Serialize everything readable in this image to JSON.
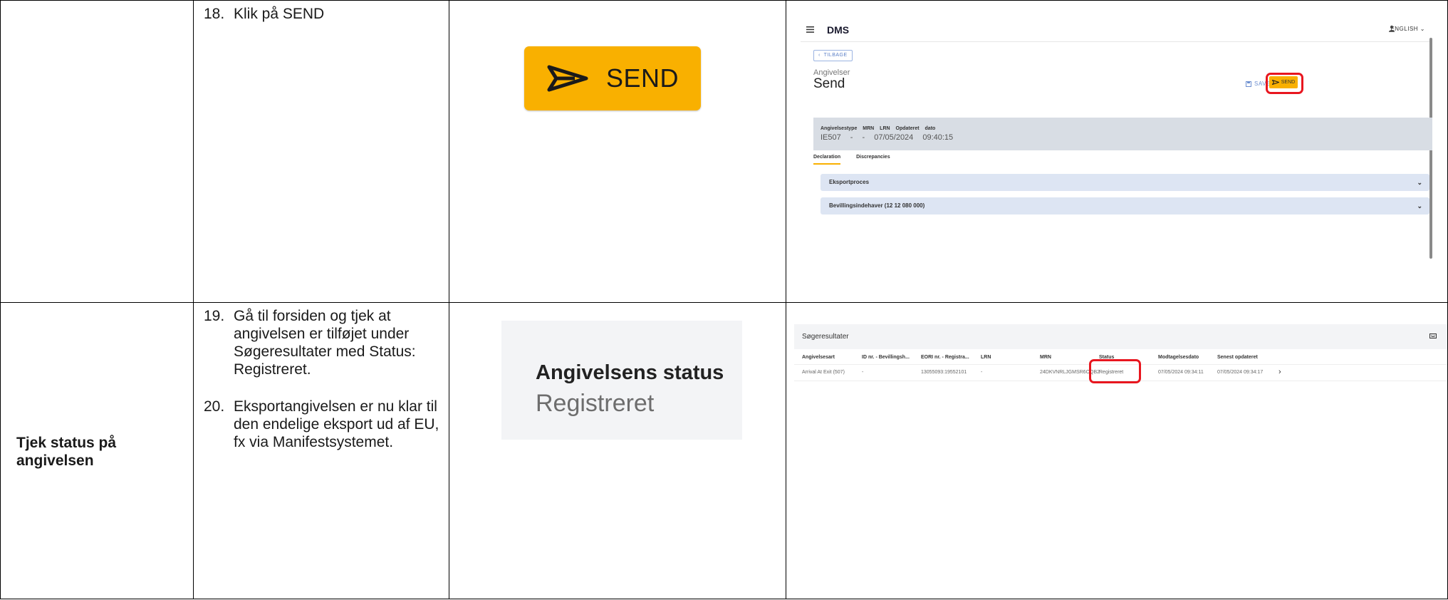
{
  "rows": [
    {
      "title": "",
      "steps": [
        {
          "num": "18.",
          "text": "Klik på SEND"
        }
      ],
      "zoom": {
        "label": "SEND",
        "icon": "send-icon",
        "color": "#f9b000"
      },
      "screenshot": {
        "brand": "DMS",
        "language": "ENGLISH",
        "back_label": "TILBAGE",
        "breadcrumb": "Angivelser",
        "heading": "Send",
        "save_label": "SAVE",
        "send_label": "SEND",
        "info_header": "Angivelsestype  MRN  LRN  Opdateret dato",
        "info_values": "IE507   -   -   07/05/2024 09:40:15",
        "tabs": [
          "Declaration",
          "Discrepancies"
        ],
        "accordions": [
          "Eksportproces",
          "Bevillingsindehaver (12 12 080 000)"
        ],
        "highlight_color": "#e8161f"
      }
    },
    {
      "title": "Tjek status på angivelsen",
      "steps": [
        {
          "num": "19.",
          "text": "Gå til forsiden og tjek at angivelsen er tilføjet under Søgeresultater med Status: Registreret."
        },
        {
          "num": "20.",
          "text": "Eksportangivelsen er nu klar til den endelige eksport ud af EU, fx via Manifestsystemet."
        }
      ],
      "zoom": {
        "label": "Angivelsens status",
        "value": "Registreret"
      },
      "screenshot": {
        "title": "Søgeresultater",
        "columns": [
          "Angivelsesart",
          "ID nr. - Bevillingsh...",
          "EORI nr. - Registra...",
          "LRN",
          "MRN",
          "Status",
          "Modtagelsesdato",
          "Senest opdateret"
        ],
        "row": [
          "Arrival At Exit (507)",
          "-",
          "13055093:19552101",
          "-",
          "24DKVNRLJGMSR6OQB2",
          "Registreret",
          "07/05/2024 09:34:11",
          "07/05/2024 09:34:17"
        ]
      }
    }
  ]
}
